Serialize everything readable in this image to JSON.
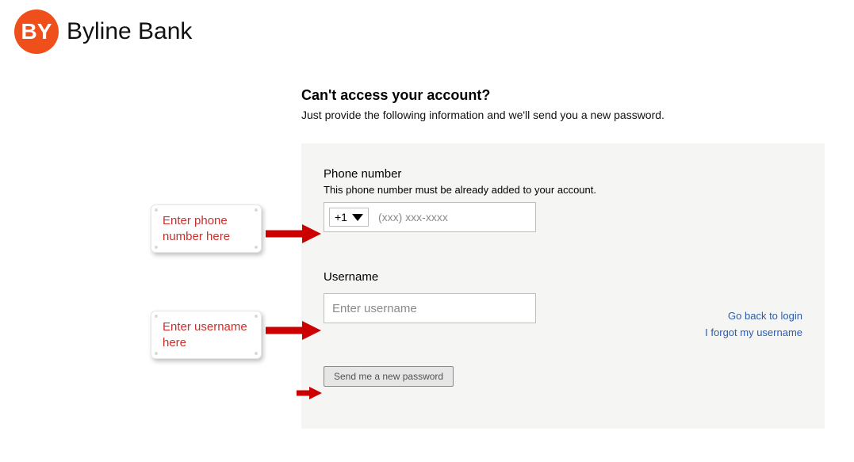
{
  "brand": {
    "logo_initials": "BY",
    "name": "Byline Bank"
  },
  "page": {
    "heading": "Can't access your account?",
    "subtext": "Just provide the following information and we'll send you a new password."
  },
  "form": {
    "phone_label": "Phone number",
    "phone_hint": "This phone number must be already added to your account.",
    "country_code": "+1",
    "phone_placeholder": "(xxx) xxx-xxxx",
    "username_label": "Username",
    "username_placeholder": "Enter username",
    "submit_label": "Send me a new password"
  },
  "links": {
    "back": "Go back to login",
    "forgot_username": "I forgot my username"
  },
  "annotations": {
    "phone": "Enter phone number here",
    "username": "Enter username here"
  }
}
